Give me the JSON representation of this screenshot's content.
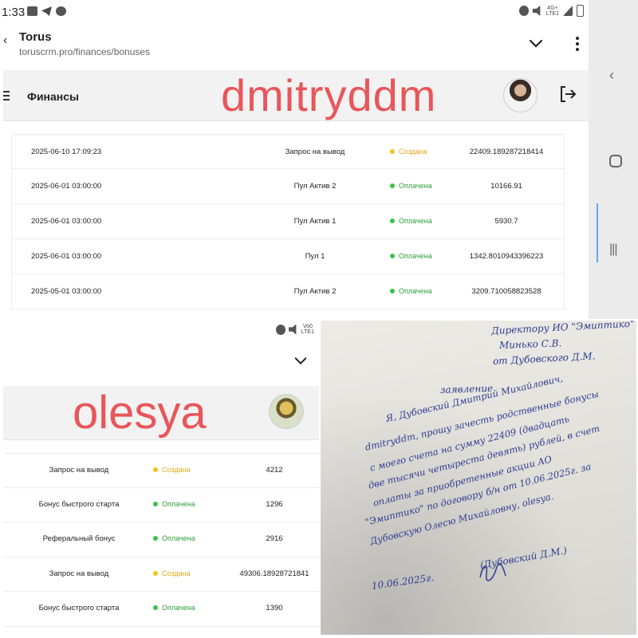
{
  "status_bar": {
    "time": "1:33",
    "network": "4G+",
    "network_sub": "LTE1",
    "left_signal": "Vo0\nLTE1"
  },
  "browser": {
    "title": "Torus",
    "url": "toruscrm.pro/finances/bonuses"
  },
  "top_app": {
    "title": "Финансы",
    "watermark": "dmitryddm",
    "rows": [
      {
        "date": "2025-06-10 17:09:23",
        "type": "Запрос на вывод",
        "status": "Создана",
        "status_color": "#f2c025",
        "amount": "22409.189287218414"
      },
      {
        "date": "2025-06-01 03:00:00",
        "type": "Пул Актив 2",
        "status": "Оплачена",
        "status_color": "#3cc14a",
        "amount": "10166.91"
      },
      {
        "date": "2025-06-01 03:00:00",
        "type": "Пул Актив 1",
        "status": "Оплачена",
        "status_color": "#3cc14a",
        "amount": "5930.7"
      },
      {
        "date": "2025-06-01 03:00:00",
        "type": "Пул 1",
        "status": "Оплачена",
        "status_color": "#3cc14a",
        "amount": "1342.8010943396223"
      },
      {
        "date": "2025-05-01 03:00:00",
        "type": "Пул Актив 2",
        "status": "Оплачена",
        "status_color": "#3cc14a",
        "amount": "3209.710058823528"
      }
    ]
  },
  "left_app": {
    "watermark": "olesya",
    "rows": [
      {
        "type": "Запрос на вывод",
        "status": "Создана",
        "status_color": "#f2c025",
        "amount": "4212"
      },
      {
        "type": "Бонус быстрого старта",
        "status": "Оплачена",
        "status_color": "#3cc14a",
        "amount": "1296"
      },
      {
        "type": "Реферальный бонус",
        "status": "Оплачена",
        "status_color": "#3cc14a",
        "amount": "2916"
      },
      {
        "type": "Запрос на вывод",
        "status": "Создана",
        "status_color": "#f2c025",
        "amount": "49306.18928721841"
      },
      {
        "type": "Бонус быстрого старта",
        "status": "Оплачена",
        "status_color": "#3cc14a",
        "amount": "1390"
      }
    ]
  },
  "document": {
    "address": [
      "Директору ИО \"Эмиптико\"",
      "Минько С.В.",
      "от Дубовского Д.М."
    ],
    "heading": "заявление",
    "body": [
      "Я, Дубовский Дмитрий Михайлович,",
      "dmitryddm, прошу зачесть родственные бонусы",
      "с моего счета на сумму 22409 (двадцать",
      "две тысячи четыреста девять) рублей, в счет",
      "оплаты за приобретенные акции АО",
      "\"Эмиптико\" по договору б/н от 10.06.2025г. за",
      "Дубовскую Олесю Михайловну, olesya."
    ],
    "date": "10.06.2025г.",
    "signature": "(Дубовский Д.М.)"
  }
}
